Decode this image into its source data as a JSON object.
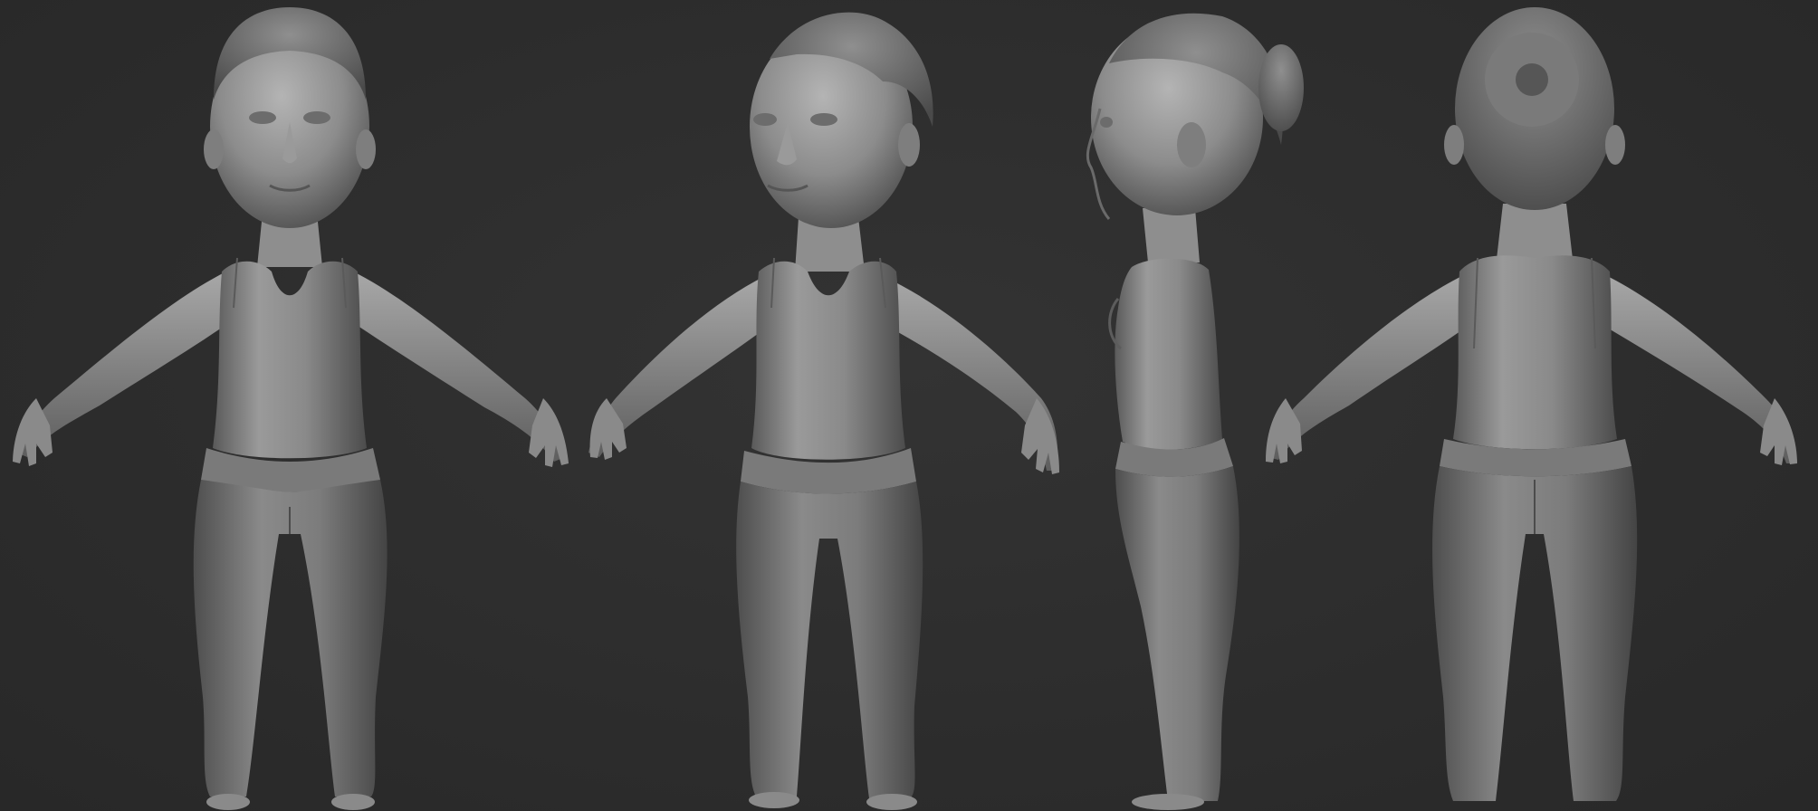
{
  "scene": {
    "description_hidden": "",
    "background_color": "#2d2d2d",
    "clay_color": "#8a8a8a",
    "views": [
      {
        "id": "front",
        "kind": "front-view"
      },
      {
        "id": "three-quarter",
        "kind": "three-quarter-view"
      },
      {
        "id": "side",
        "kind": "side-view"
      },
      {
        "id": "back",
        "kind": "back-view"
      }
    ]
  }
}
